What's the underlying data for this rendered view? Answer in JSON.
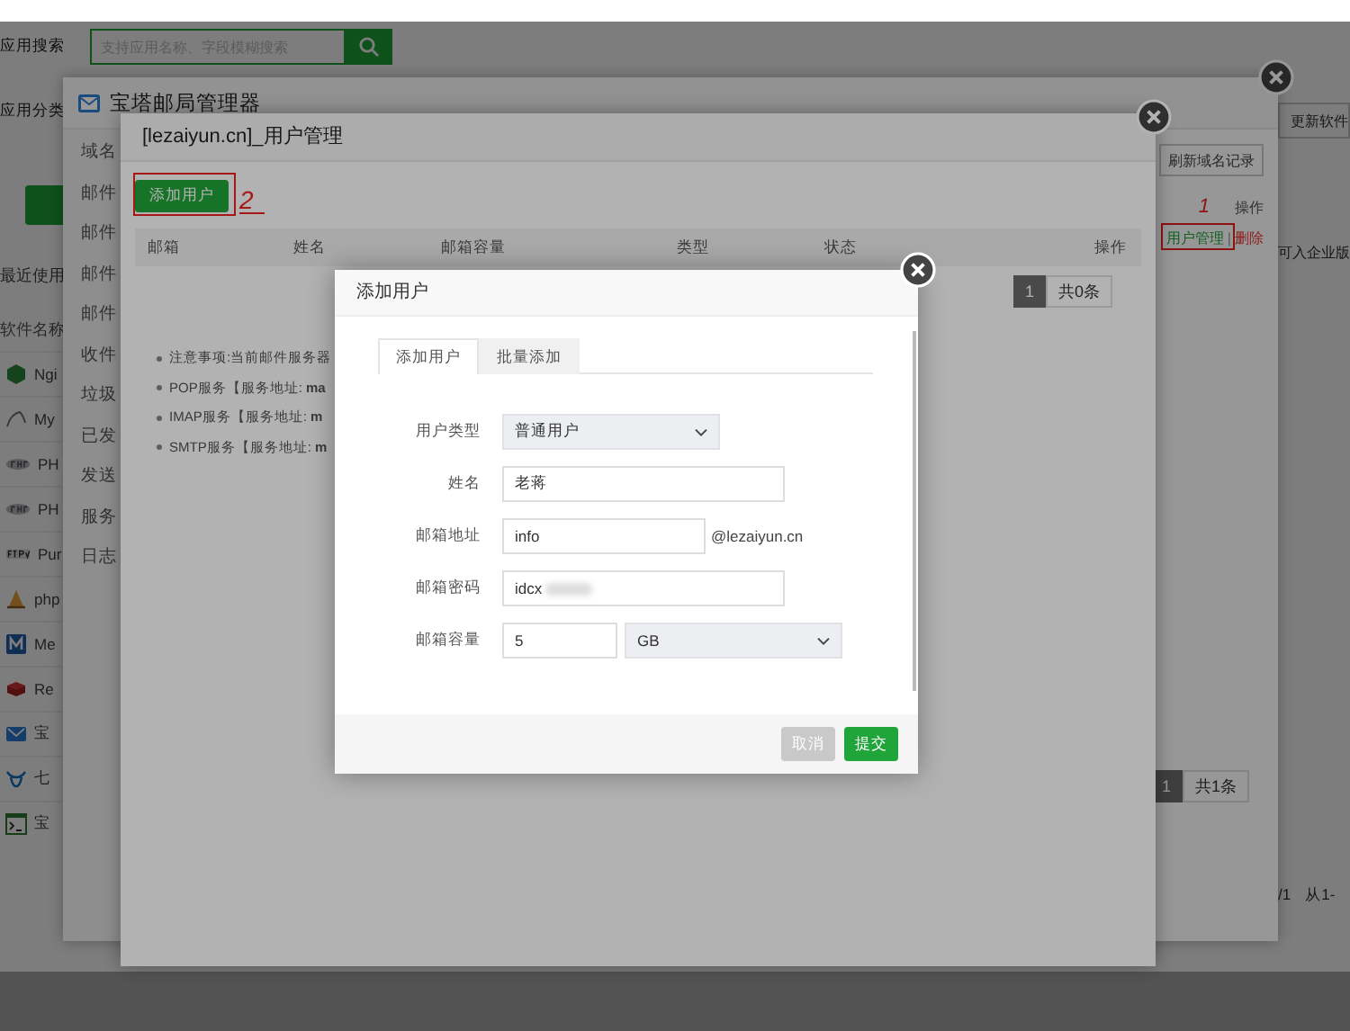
{
  "background": {
    "search_label": "应用搜索",
    "search_placeholder": "支持应用名称、字段模糊搜索",
    "category_label": "应用分类",
    "recent_label": "最近使用",
    "column_header": "软件名称",
    "software": [
      {
        "name": "Ngi",
        "kind": "nginx"
      },
      {
        "name": "My",
        "kind": "mysql"
      },
      {
        "name": "PH",
        "kind": "php"
      },
      {
        "name": "PH",
        "kind": "php"
      },
      {
        "name": "Pur",
        "kind": "ftp"
      },
      {
        "name": "php",
        "kind": "admin"
      },
      {
        "name": "Me",
        "kind": "memcached"
      },
      {
        "name": "Re",
        "kind": "redis"
      },
      {
        "name": "宝",
        "kind": "mail"
      },
      {
        "name": "七",
        "kind": "cloud"
      },
      {
        "name": "宝",
        "kind": "terminal"
      }
    ],
    "update_button": "更新软件",
    "notice": "可入企业版",
    "page_info": "/1",
    "range": "从1-"
  },
  "mail_manager": {
    "title": "宝塔邮局管理器",
    "sidebar": [
      "域名",
      "邮件",
      "邮件",
      "邮件",
      "邮件",
      "收件",
      "垃圾",
      "已发",
      "发送",
      "服务",
      "日志"
    ],
    "refresh_button": "刷新域名记录",
    "action_header": "操作",
    "user_manage_link": "用户管理",
    "separator": "|",
    "delete_link": "删除",
    "annotation": "1",
    "pagination": {
      "page": "1",
      "total": "共1条"
    }
  },
  "user_manager": {
    "title": "[lezaiyun.cn]_用户管理",
    "add_button": "添加用户",
    "annotation": "2",
    "columns": [
      "邮箱",
      "姓名",
      "邮箱容量",
      "类型",
      "状态",
      "操作"
    ],
    "pagination": {
      "page": "1",
      "total": "共0条"
    },
    "notes": [
      "注意事项:当前邮件服务器",
      "POP服务【服务地址: **ma**",
      "IMAP服务【服务地址: **m**",
      "SMTP服务【服务地址: **m**"
    ]
  },
  "dialog": {
    "title": "添加用户",
    "tabs": [
      {
        "label": "添加用户",
        "selected": true
      },
      {
        "label": "批量添加",
        "selected": false
      }
    ],
    "fields": [
      {
        "label": "用户类型",
        "kind": "select",
        "value": "普通用户"
      },
      {
        "label": "姓名",
        "kind": "input",
        "value": "老蒋"
      },
      {
        "label": "邮箱地址",
        "kind": "suffix",
        "value": "info",
        "suffix": "@lezaiyun.cn"
      },
      {
        "label": "邮箱密码",
        "kind": "input",
        "value": "idcx",
        "redacted": true
      },
      {
        "label": "邮箱容量",
        "kind": "quota",
        "value": "5",
        "unit": "GB"
      }
    ],
    "cancel_button": "取消",
    "submit_button": "提交"
  }
}
